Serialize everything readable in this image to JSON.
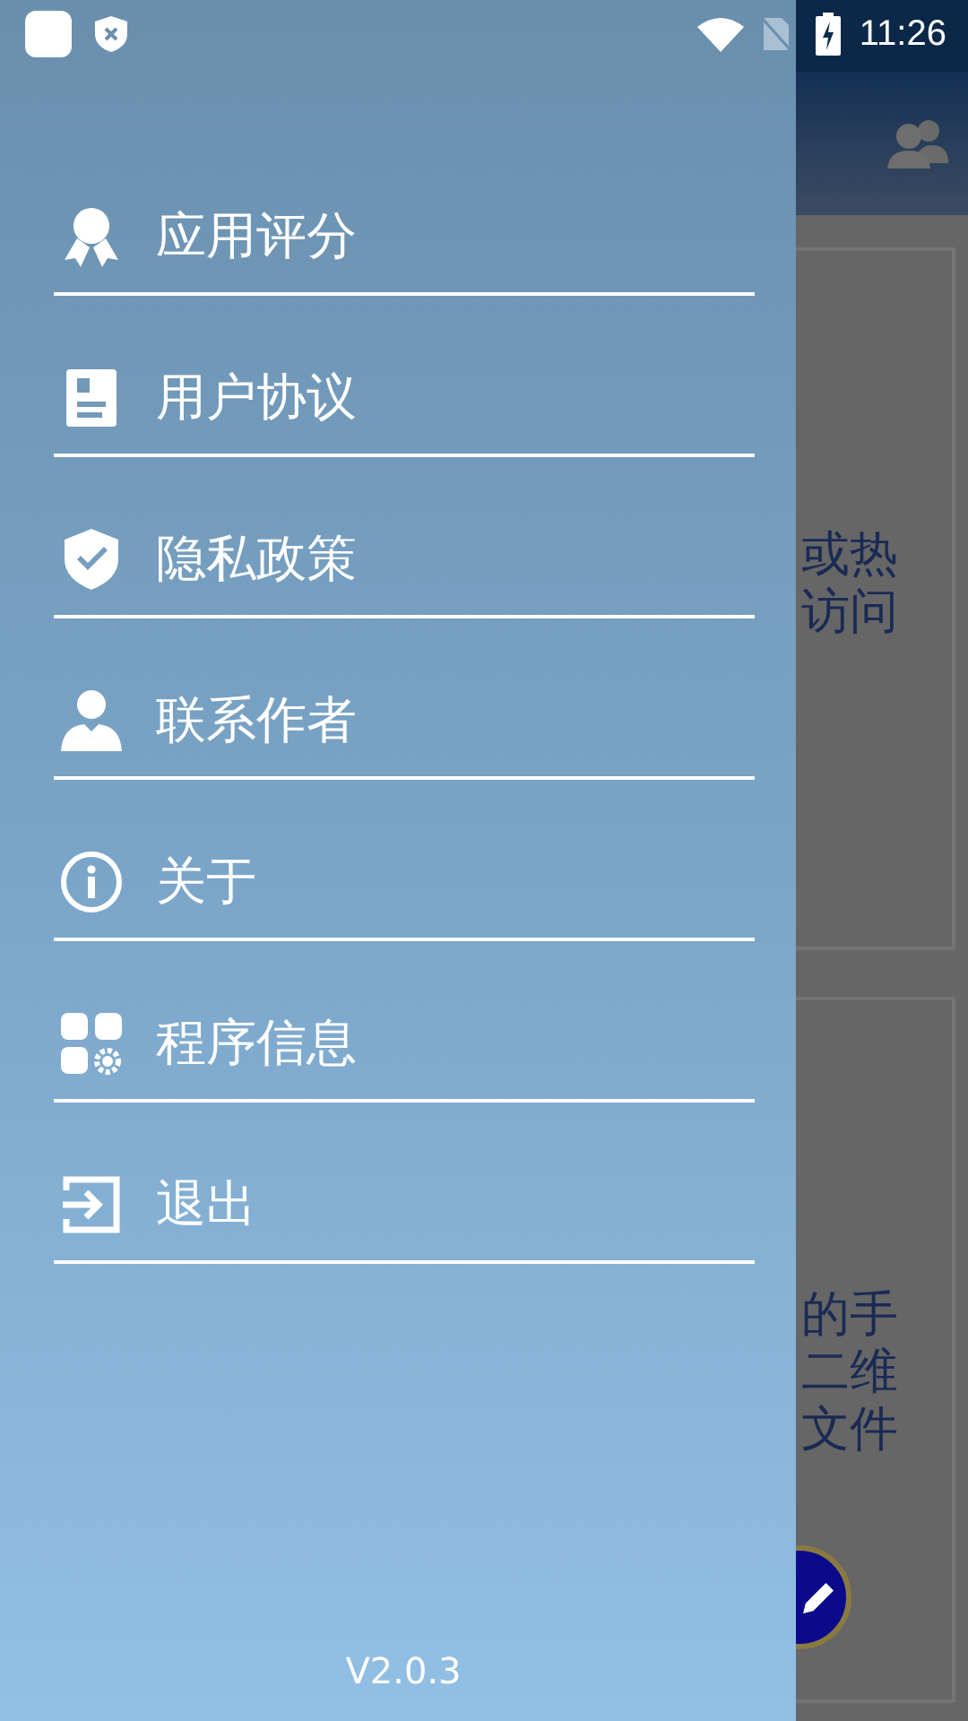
{
  "status_bar": {
    "time": "11:26"
  },
  "drawer": {
    "items": [
      {
        "kind": "award",
        "label": "应用评分"
      },
      {
        "kind": "document",
        "label": "用户协议"
      },
      {
        "kind": "shield",
        "label": "隐私政策"
      },
      {
        "kind": "person",
        "label": "联系作者"
      },
      {
        "kind": "info",
        "label": "关于"
      },
      {
        "kind": "apps",
        "label": "程序信息"
      },
      {
        "kind": "exit",
        "label": "退出"
      }
    ],
    "version": "V2.0.3"
  },
  "background_cards": [
    {
      "lines": [
        "或热",
        "访问"
      ]
    },
    {
      "lines": [
        "的手",
        "二维",
        "文件"
      ]
    }
  ]
}
